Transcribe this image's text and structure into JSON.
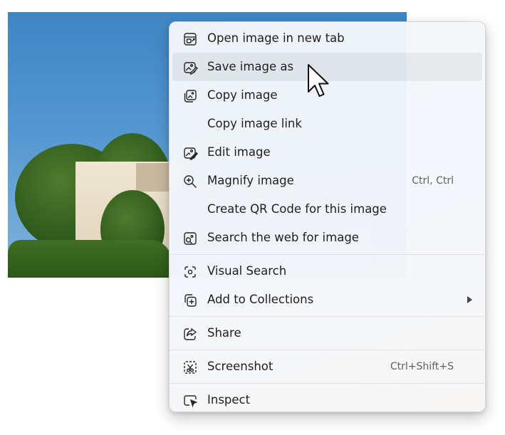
{
  "menu": {
    "items": [
      {
        "label": "Open image in new tab",
        "icon": "open-in-new-tab-icon",
        "shortcut": ""
      },
      {
        "label": "Save image as",
        "icon": "save-image-icon",
        "shortcut": ""
      },
      {
        "label": "Copy image",
        "icon": "copy-image-icon",
        "shortcut": ""
      },
      {
        "label": "Copy image link",
        "icon": "",
        "shortcut": ""
      },
      {
        "label": "Edit image",
        "icon": "edit-image-icon",
        "shortcut": ""
      },
      {
        "label": "Magnify image",
        "icon": "magnify-icon",
        "shortcut": "Ctrl, Ctrl"
      },
      {
        "label": "Create QR Code for this image",
        "icon": "",
        "shortcut": ""
      },
      {
        "label": "Search the web for image",
        "icon": "search-web-image-icon",
        "shortcut": ""
      },
      {
        "label": "Visual Search",
        "icon": "visual-search-icon",
        "shortcut": ""
      },
      {
        "label": "Add to Collections",
        "icon": "add-to-collections-icon",
        "shortcut": ""
      },
      {
        "label": "Share",
        "icon": "share-icon",
        "shortcut": ""
      },
      {
        "label": "Screenshot",
        "icon": "screenshot-icon",
        "shortcut": "Ctrl+Shift+S"
      },
      {
        "label": "Inspect",
        "icon": "inspect-icon",
        "shortcut": ""
      }
    ],
    "hovered_item": "Save image as"
  },
  "colors": {
    "menu_background": "#f3f6fa",
    "hover_background": "#ebedf0",
    "text": "#1f1f1f",
    "shortcut_text": "#5f5f5f"
  }
}
